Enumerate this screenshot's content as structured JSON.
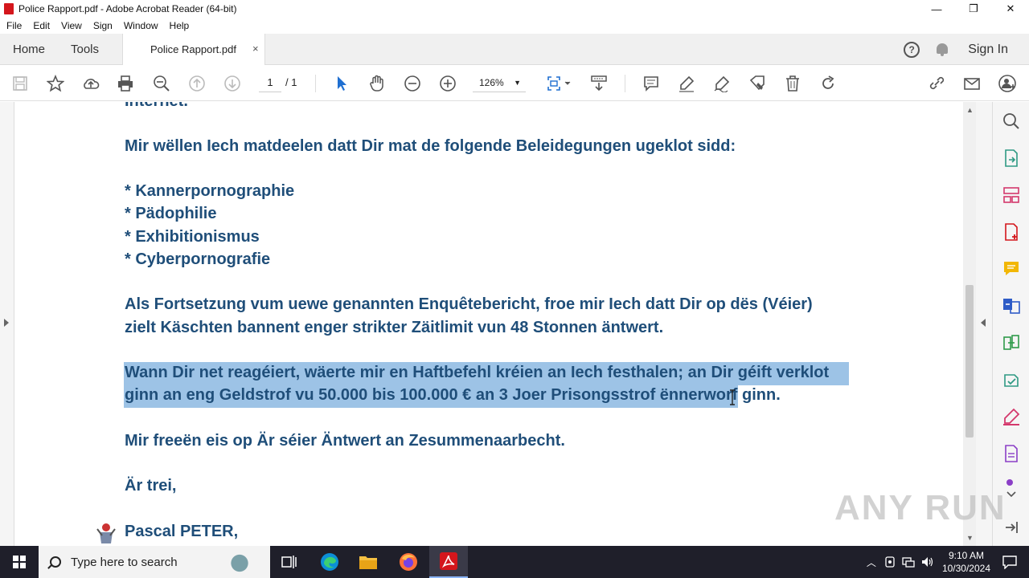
{
  "window": {
    "title": "Police Rapport.pdf - Adobe Acrobat Reader (64-bit)",
    "minimize": "—",
    "maximize": "❐",
    "close": "✕"
  },
  "menu": [
    "File",
    "Edit",
    "View",
    "Sign",
    "Window",
    "Help"
  ],
  "tabs": {
    "home": "Home",
    "tools": "Tools",
    "document": "Police Rapport.pdf",
    "close": "×",
    "sign_in": "Sign In",
    "help": "?"
  },
  "toolbar": {
    "current_page": "1",
    "page_of": "/ 1",
    "zoom": "126%",
    "zoom_caret": "▼"
  },
  "document": {
    "lines": [
      "Internet.",
      "Mir wëllen Iech matdeelen datt Dir mat de folgende Beleidegungen ugeklot sidd:",
      "* Kannerpornographie",
      "* Pädophilie",
      "* Exhibitionismus",
      "* Cyberpornografie",
      "Als Fortsetzung vum uewe genannten Enquêtebericht, froe mir Iech datt Dir op dës (Véier)",
      "zielt Käschten bannent enger strikter Zäitlimit vun 48 Stonnen äntwert.",
      "Wann Dir net reagéiert, wäerte mir en Haftbefehl kréien an Iech festhalen; an Dir géift verklot",
      "ginn an eng Geldstrof vu 50.000 bis 100.000 € an 3 Joer Prisongsstrof ënnerworf ginn.",
      "Mir freeën eis op Är séier Äntwert an Zesummenaarbecht.",
      "Är trei,",
      "Pascal PETER,"
    ]
  },
  "watermark": "ANY RUN",
  "taskbar": {
    "search_placeholder": "Type here to search",
    "time": "9:10 AM",
    "date": "10/30/2024"
  },
  "colors": {
    "text": "#1f4e79",
    "selection": "#9dc3e6",
    "acrobat_red": "#d4161c"
  }
}
